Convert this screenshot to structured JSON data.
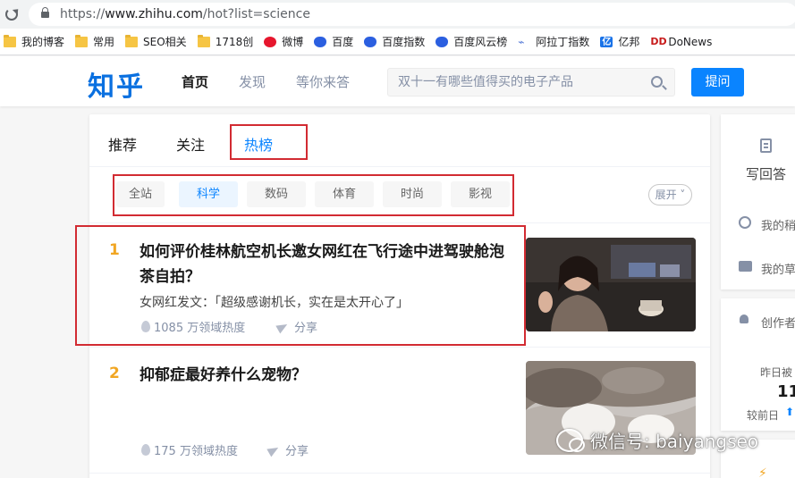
{
  "browser": {
    "url_prefix": "https://",
    "url_host": "www.zhihu.com",
    "url_path": "/hot?list=science"
  },
  "bookmarks": [
    {
      "label": "我的博客",
      "icon": "folder-icon"
    },
    {
      "label": "常用",
      "icon": "folder-icon"
    },
    {
      "label": "SEO相关",
      "icon": "folder-icon"
    },
    {
      "label": "1718创",
      "icon": "folder-icon"
    },
    {
      "label": "微博",
      "icon": "weibo-icon"
    },
    {
      "label": "百度",
      "icon": "baidu-paw-icon"
    },
    {
      "label": "百度指数",
      "icon": "baidu-paw-icon"
    },
    {
      "label": "百度风云榜",
      "icon": "baidu-paw-icon"
    },
    {
      "label": "阿拉丁指数",
      "icon": "aladdin-icon"
    },
    {
      "label": "亿邦",
      "icon": "yibang-icon"
    },
    {
      "label": "DoNews",
      "icon": "donews-icon"
    }
  ],
  "header": {
    "logo": "知乎",
    "nav": [
      "首页",
      "发现",
      "等你来答"
    ],
    "search_placeholder": "双十一有哪些值得买的电子产品",
    "ask_button": "提问"
  },
  "feed_tabs": [
    "推荐",
    "关注",
    "热榜"
  ],
  "categories": [
    "全站",
    "科学",
    "数码",
    "体育",
    "时尚",
    "影视"
  ],
  "expand_label": "展开",
  "hot_items": [
    {
      "rank": "1",
      "title": "如何评价桂林航空机长邀女网红在飞行途中进驾驶舱泡茶自拍？",
      "excerpt": "女网红发文：「超级感谢机长，实在是太开心了」",
      "heat": "1085 万领域热度",
      "share": "分享"
    },
    {
      "rank": "2",
      "title": "抑郁症最好养什么宠物？",
      "excerpt": "",
      "heat": "175 万领域热度",
      "share": "分享"
    }
  ],
  "sidebar": {
    "write_answer": "写回答",
    "item1": "我的稍",
    "item2": "我的草",
    "creator": "创作者",
    "yesterday": "昨日被",
    "count": "11",
    "prev_day": "较前日"
  },
  "watermark": "微信号: baiyangseo",
  "colors": {
    "accent": "#0a84ff",
    "rank": "#f1a623",
    "highlight": "#d22b32"
  }
}
